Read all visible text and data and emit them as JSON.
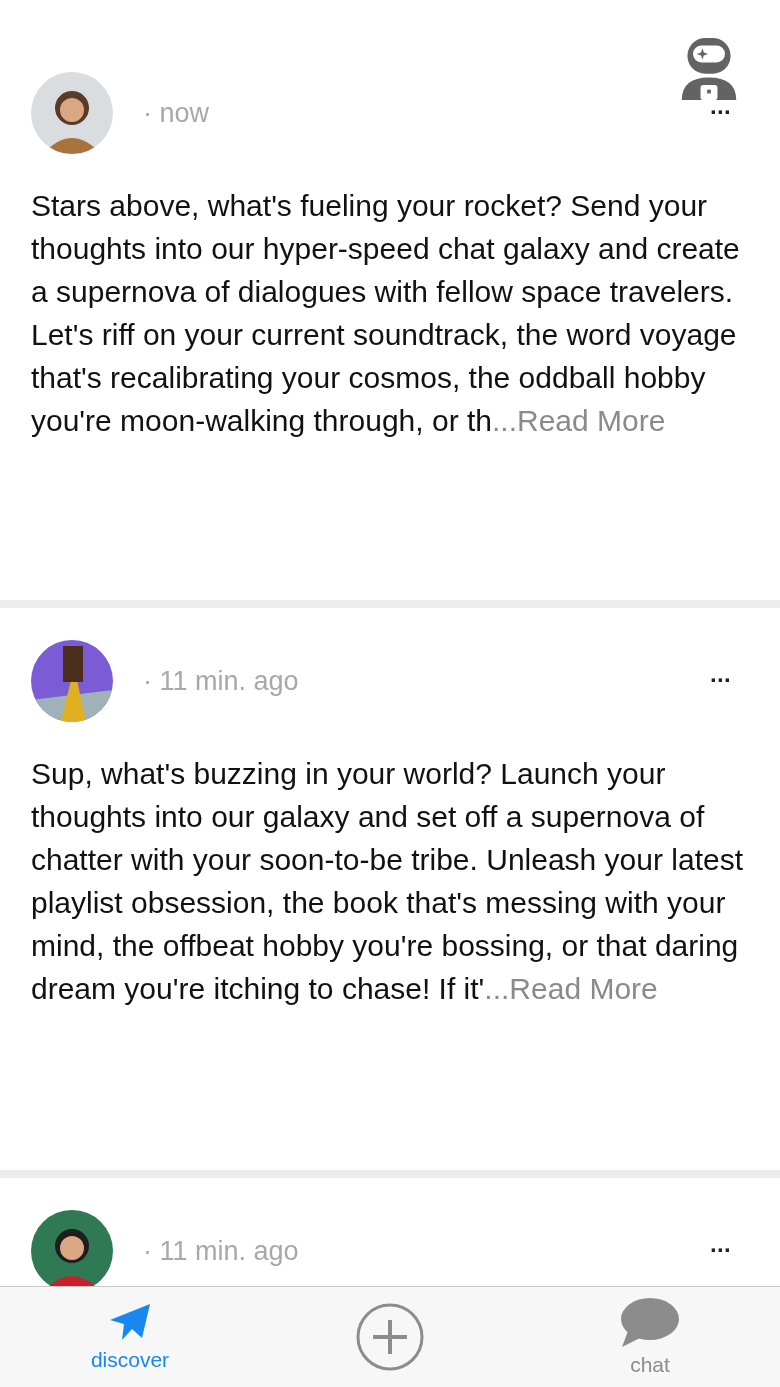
{
  "posts": [
    {
      "time": "· now",
      "body": "Stars above, what's fueling your rocket? Send your thoughts into our hyper-speed chat galaxy and create a supernova of dialogues with fellow space travelers. Let's riff on your current soundtrack, the word voyage that's recalibrating your cosmos, the oddball hobby you're moon-walking through, or th",
      "more": "...Read More",
      "menu": "···"
    },
    {
      "time": "· 11 min. ago",
      "body": "Sup, what's buzzing in your world? Launch your thoughts into our galaxy and set off a supernova of chatter with your soon-to-be tribe. Unleash your latest playlist obsession, the book that's messing with your mind, the offbeat hobby you're bossing, or that daring dream you're itching to chase! If it'",
      "more": "...Read More",
      "menu": "···"
    },
    {
      "time": "· 11 min. ago",
      "menu": "···"
    }
  ],
  "tabs": [
    {
      "kind": "discover",
      "label": "discover",
      "selected": true
    },
    {
      "kind": "add"
    },
    {
      "kind": "chat",
      "label": "chat",
      "selected": false
    }
  ]
}
